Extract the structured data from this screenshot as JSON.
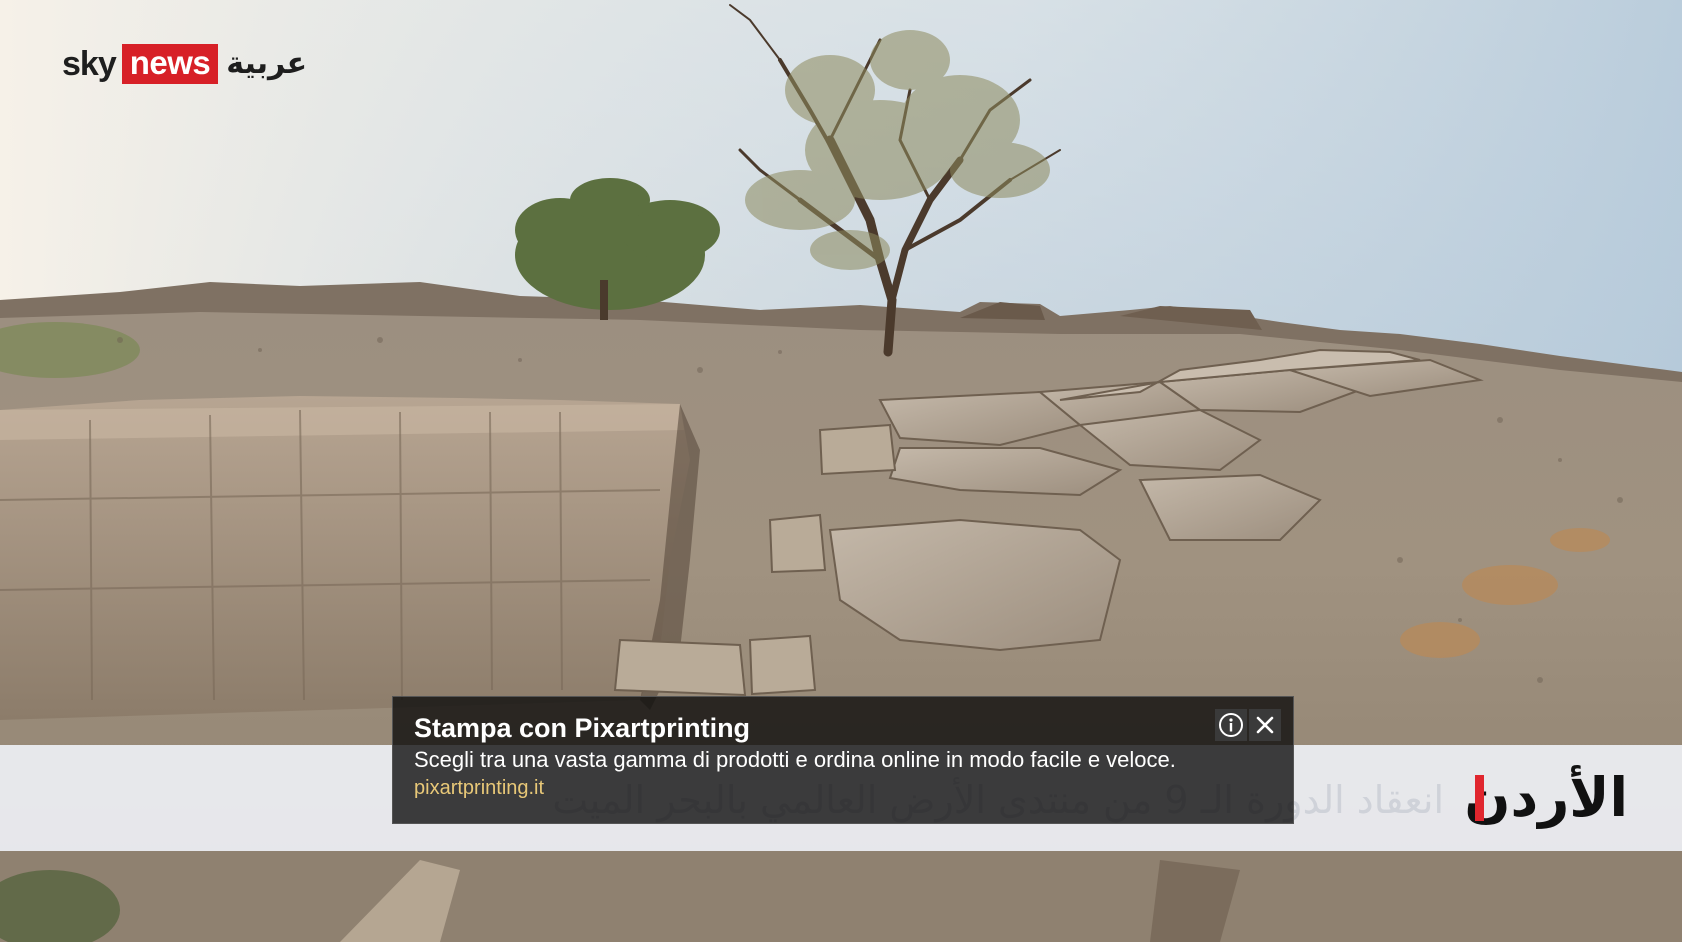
{
  "logo": {
    "brand_sky": "sky",
    "brand_news": "news",
    "brand_arabic": "عربية",
    "news_color": "#d72027"
  },
  "lower_third": {
    "country": "الأردن",
    "headline": "انعقاد الدورة الـ 9 من منتدى الأرض العالمي بالبحر الميت",
    "accent_color": "#e0262e"
  },
  "ad": {
    "title": "Stampa con Pixartprinting",
    "description": "Scegli tra una vasta gamma di prodotti e ordina online in modo facile e veloce.",
    "url": "pixartprinting.it",
    "info_icon": "info-icon",
    "close_icon": "close-icon"
  }
}
